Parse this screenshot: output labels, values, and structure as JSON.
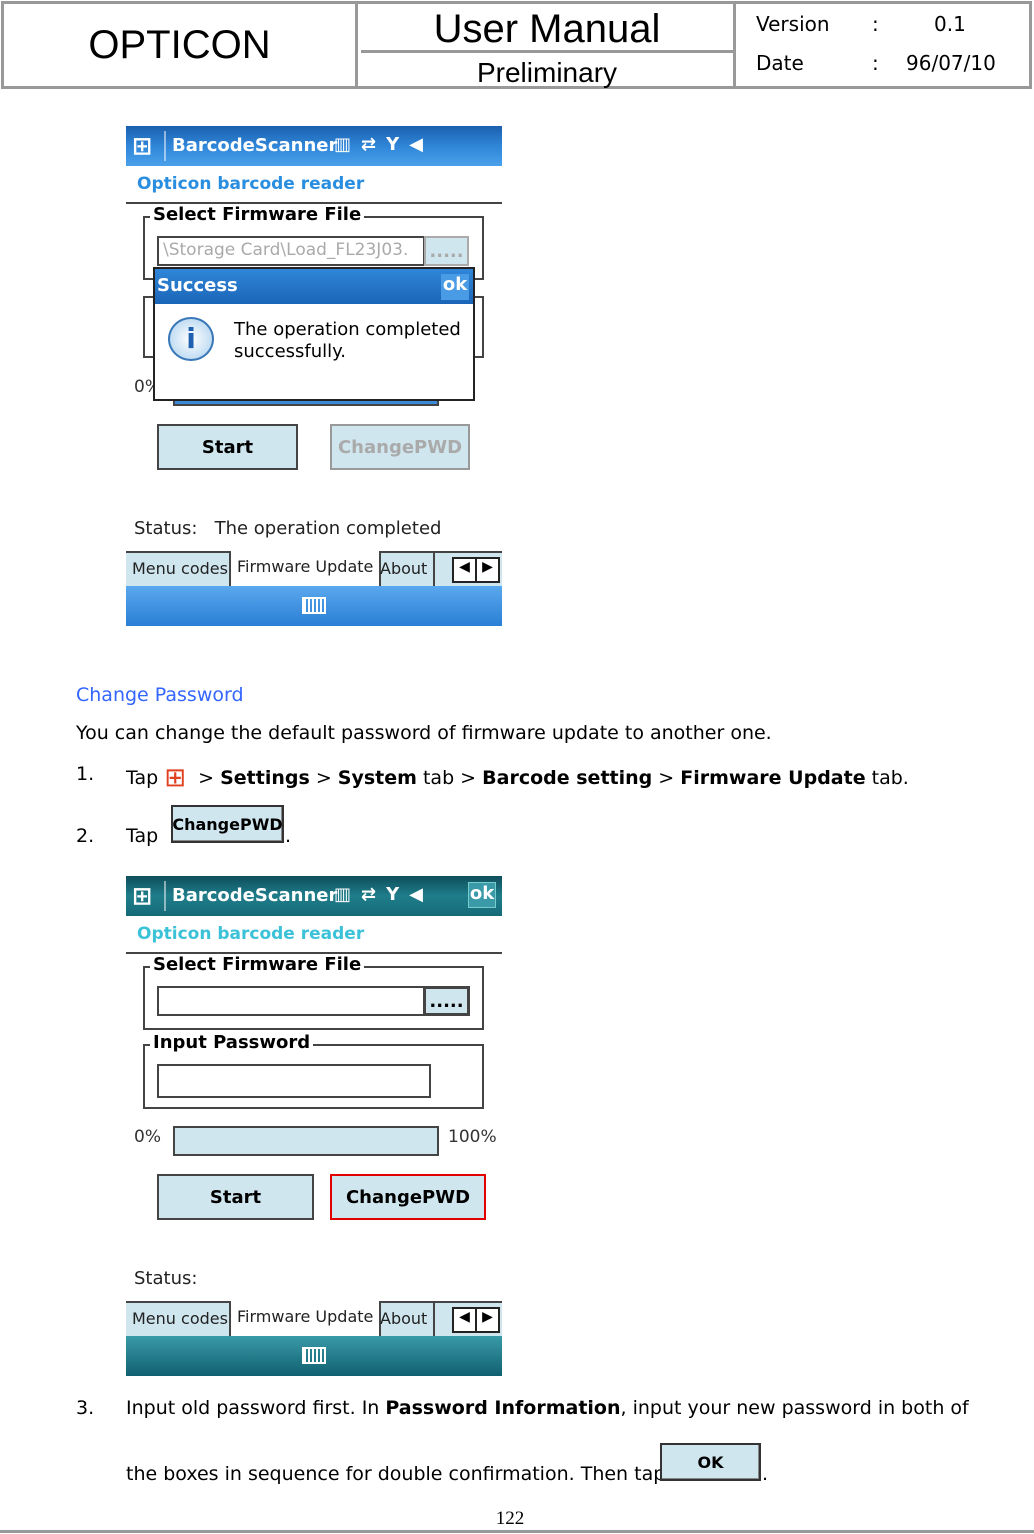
{
  "header": {
    "company": "OPTICON",
    "title": "User Manual",
    "subtitle": "Preliminary",
    "version_label": "Version",
    "version_sep": ":",
    "version": "0.1",
    "date_label": "Date",
    "date_sep": ":",
    "date": "96/07/10"
  },
  "screen1": {
    "app": "BarcodeScanner",
    "heading": "Opticon barcode reader",
    "group1": "Select Firmware File",
    "file": "\\Storage Card\\Load_FL23J03.",
    "browse": ".....",
    "pct0": "0%",
    "start": "Start",
    "changepwd": "ChangePWD",
    "status_label": "Status:",
    "status_value": "The operation completed",
    "tabs": [
      "Menu codes",
      "Firmware Update",
      "About"
    ],
    "dialog": {
      "title": "Success",
      "ok": "ok",
      "message": "The operation completed successfully."
    }
  },
  "section": {
    "title": "Change Password",
    "intro": "You can change the default password of firmware update to another one.",
    "step1_num": "1.",
    "step1_tap": "Tap",
    "step1_gt1": ">",
    "step1_settings": "Settings",
    "step1_gt2": ">",
    "step1_system": "System",
    "step1_tab1": "tab >",
    "step1_barcode": "Barcode setting",
    "step1_gt3": ">",
    "step1_fw": "Firmware Update",
    "step1_tab2": "tab.",
    "step2_num": "2.",
    "step2_tap": "Tap",
    "step2_btn": "ChangePWD",
    "step2_end": ".",
    "step3_num": "3.",
    "step3_a": "Input old password first. In ",
    "step3_b": "Password Information",
    "step3_c": ", input your new password in both of",
    "step3_d": "the boxes in sequence for double confirmation. Then tap",
    "step3_btn": "OK",
    "step3_end": "."
  },
  "screen2": {
    "app": "BarcodeScanner",
    "ok": "ok",
    "heading": "Opticon barcode reader",
    "group1": "Select Firmware File",
    "browse": ".....",
    "group2": "Input Password",
    "pct0": "0%",
    "pct100": "100%",
    "progress": 0,
    "start": "Start",
    "changepwd": "ChangePWD",
    "status_label": "Status:",
    "tabs": [
      "Menu codes",
      "Firmware Update",
      "About"
    ]
  },
  "page_number": "122",
  "colors": {
    "link": "#3366ff",
    "accent_red": "#e00000"
  }
}
